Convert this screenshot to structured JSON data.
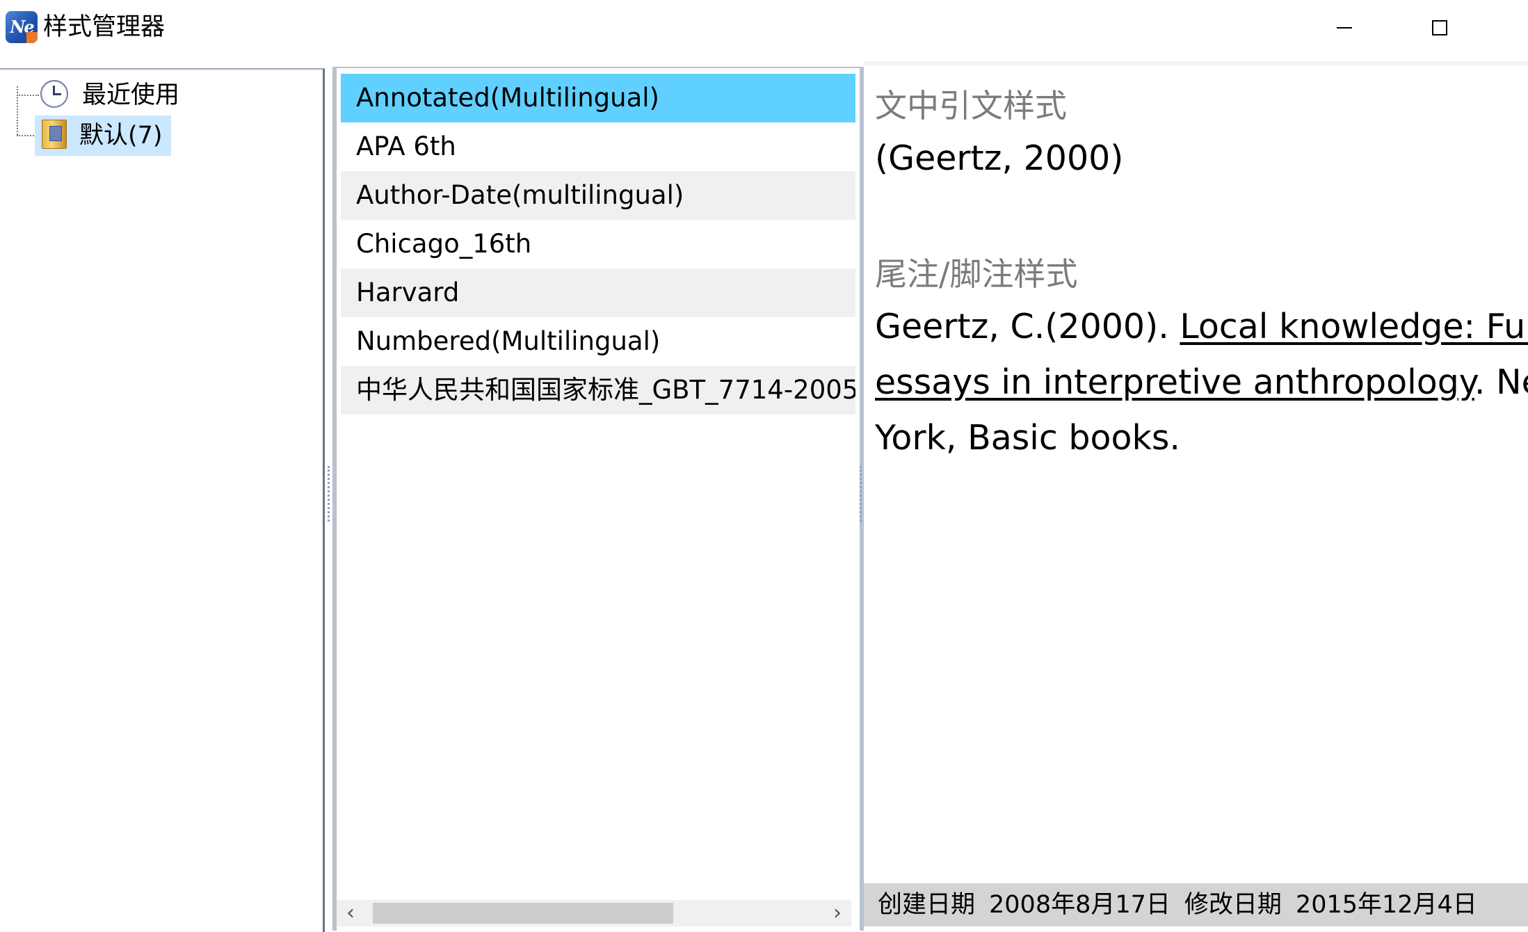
{
  "window": {
    "title": "样式管理器",
    "icon_text": "Ne",
    "controls": {
      "minimize": "minimize-icon",
      "maximize": "maximize-icon"
    }
  },
  "tree": {
    "items": [
      {
        "label": "最近使用",
        "icon": "clock-icon"
      },
      {
        "label": "默认(7)",
        "icon": "folder-icon",
        "selected": true
      }
    ]
  },
  "style_list": {
    "items": [
      {
        "label": "Annotated(Multilingual)",
        "selected": true
      },
      {
        "label": "APA 6th"
      },
      {
        "label": "Author-Date(multilingual)"
      },
      {
        "label": "Chicago_16th"
      },
      {
        "label": "Harvard"
      },
      {
        "label": "Numbered(Multilingual)"
      },
      {
        "label": "中华人民共和国国家标准_GBT_7714-2005"
      }
    ],
    "scroll_left": "‹",
    "scroll_right": "›"
  },
  "preview": {
    "intext_heading": "文中引文样式",
    "intext_citation": "(Geertz, 2000)",
    "footnote_heading": "尾注/脚注样式",
    "reference": {
      "author_year": "Geertz, C.(2000). ",
      "title_part1": "Local knowledge: Further",
      "title_part2": "essays in interpretive anthropology",
      "after_title": ". New",
      "line3": "York, Basic books."
    }
  },
  "status": {
    "created_label": "创建日期",
    "created_value": "2008年8月17日",
    "modified_label": "修改日期",
    "modified_value": "2015年12月4日"
  },
  "colors": {
    "selection": "#5fd0ff",
    "tree_selection": "#cce8ff",
    "stripe": "#f0f0f0",
    "status_bg": "#d4d4d4",
    "heading_gray": "#7b7b7b"
  }
}
